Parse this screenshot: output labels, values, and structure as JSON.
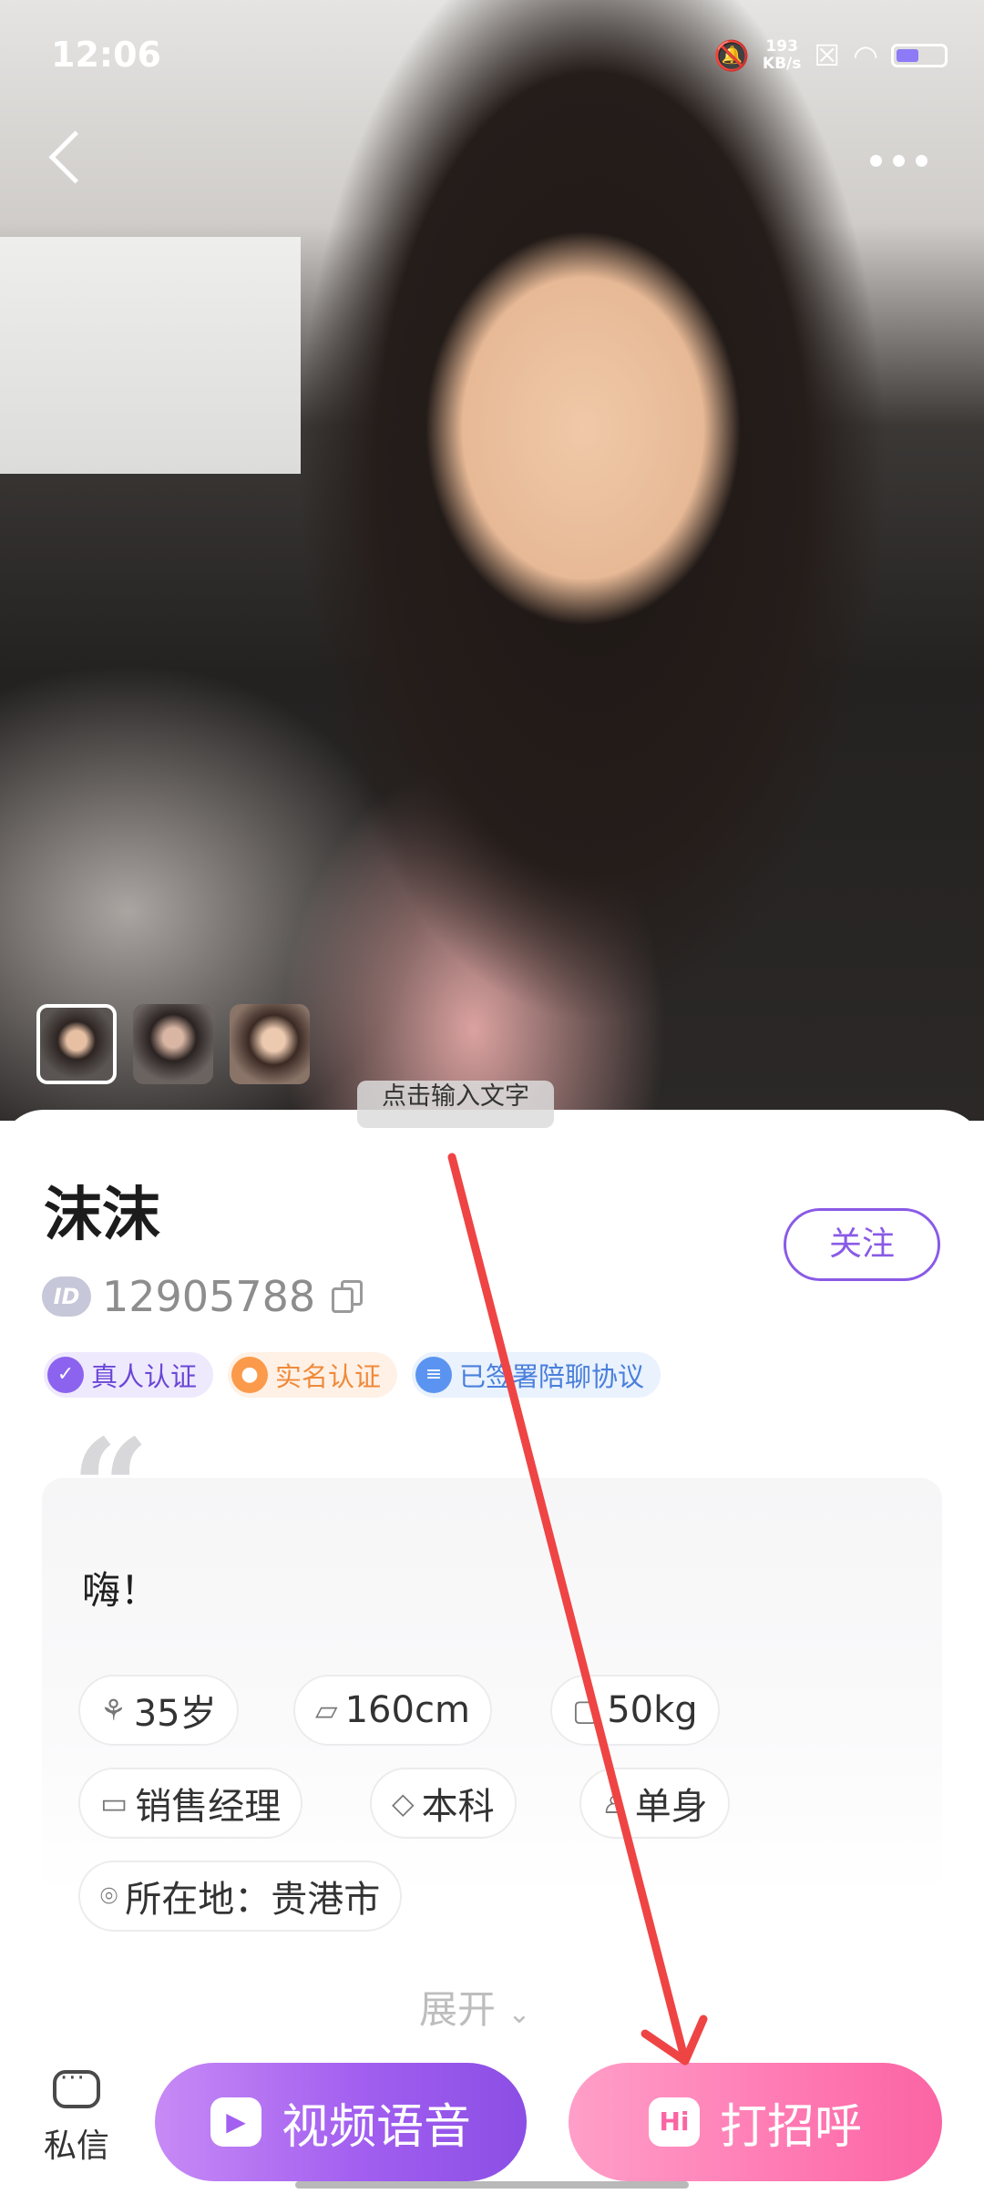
{
  "status_bar": {
    "time": "12:06",
    "network_speed": "193",
    "network_unit": "KB/s",
    "icons": [
      "mute-bell-icon",
      "network-speed-icon",
      "sim-x-icon",
      "wifi-icon",
      "battery-icon"
    ]
  },
  "nav": {
    "back_icon": "back-chevron-icon",
    "more_icon": "more-dots-icon"
  },
  "gallery": {
    "thumbnails": [
      "photo-1",
      "photo-2",
      "photo-3"
    ],
    "selected": 0
  },
  "input_hint": "点击输入文字",
  "profile": {
    "name": "沫沫",
    "id_label": "ID",
    "id_number": "12905788",
    "follow_label": "关注",
    "badges": [
      "真人认证",
      "实名认证",
      "已签署陪聊协议"
    ],
    "greeting": "嗨！",
    "tags": {
      "age": "35岁",
      "height": "160cm",
      "weight": "50kg",
      "job": "销售经理",
      "education": "本科",
      "relationship": "单身",
      "location": "所在地：贵港市"
    },
    "expand_label": "展开"
  },
  "bottom_bar": {
    "dm_label": "私信",
    "video_label": "视频语音",
    "greet_label": "打招呼",
    "greet_icon_text": "Hi"
  },
  "colors": {
    "accent_purple": "#8a5ae6",
    "accent_pink": "#fb64a4",
    "annotation_red": "#ef4444"
  }
}
